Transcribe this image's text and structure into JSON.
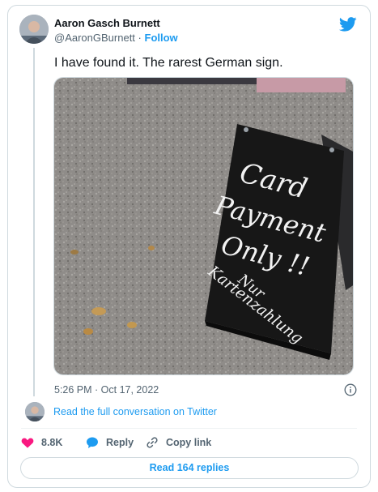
{
  "author": {
    "name": "Aaron Gasch Burnett",
    "handle": "@AaronGBurnett",
    "separator": "·",
    "follow_label": "Follow"
  },
  "tweet": {
    "text": "I have found it. The rarest German sign.",
    "image_sign_text": {
      "line1": "Card",
      "line2": "Payment",
      "line3": "Only !!",
      "line4": "Nur",
      "line5": "Kartenzahlung"
    },
    "timestamp": "5:26 PM · Oct 17, 2022"
  },
  "read_full_label": "Read the full conversation on Twitter",
  "actions": {
    "like_count": "8.8K",
    "reply_label": "Reply",
    "copy_link_label": "Copy link"
  },
  "replies_button_label": "Read 164 replies",
  "colors": {
    "brand_blue": "#1d9bf0",
    "like_pink": "#f91880",
    "secondary_text": "#536471",
    "border": "#cfd9de"
  },
  "icons": {
    "logo": "twitter-bird-icon",
    "info": "info-icon",
    "like": "heart-icon",
    "reply": "speech-bubble-icon",
    "copy_link": "link-icon"
  }
}
